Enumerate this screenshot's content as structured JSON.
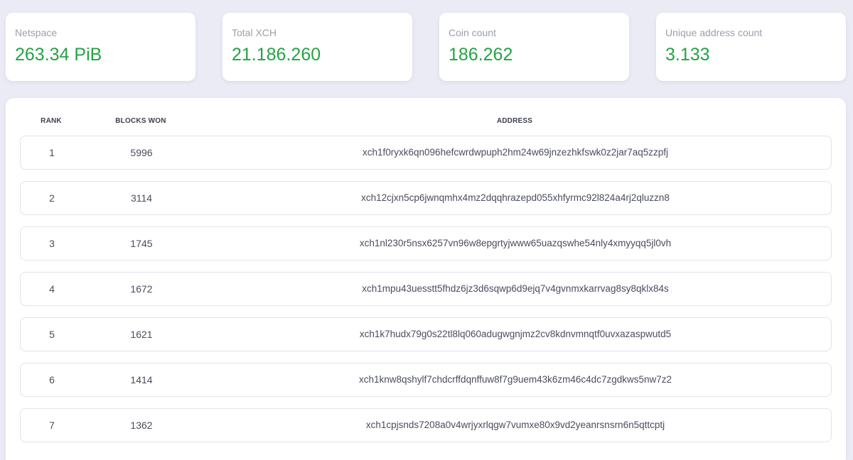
{
  "stats": [
    {
      "label": "Netspace",
      "value": "263.34 PiB"
    },
    {
      "label": "Total XCH",
      "value": "21.186.260"
    },
    {
      "label": "Coin count",
      "value": "186.262"
    },
    {
      "label": "Unique address count",
      "value": "3.133"
    }
  ],
  "table": {
    "headers": {
      "rank": "RANK",
      "blocks_won": "BLOCKS WON",
      "address": "ADDRESS"
    },
    "rows": [
      {
        "rank": "1",
        "blocks_won": "5996",
        "address": "xch1f0ryxk6qn096hefcwrdwpuph2hm24w69jnzezhkfswk0z2jar7aq5zzpfj"
      },
      {
        "rank": "2",
        "blocks_won": "3114",
        "address": "xch12cjxn5cp6jwnqmhx4mz2dqqhrazepd055xhfyrmc92l824a4rj2qluzzn8"
      },
      {
        "rank": "3",
        "blocks_won": "1745",
        "address": "xch1nl230r5nsx6257vn96w8epgrtyjwww65uazqswhe54nly4xmyyqq5jl0vh"
      },
      {
        "rank": "4",
        "blocks_won": "1672",
        "address": "xch1mpu43uesstt5fhdz6jz3d6sqwp6d9ejq7v4gvnmxkarrvag8sy8qklx84s"
      },
      {
        "rank": "5",
        "blocks_won": "1621",
        "address": "xch1k7hudx79g0s22tl8lq060adugwgnjmz2cv8kdnvmnqtf0uvxazaspwutd5"
      },
      {
        "rank": "6",
        "blocks_won": "1414",
        "address": "xch1knw8qshylf7chdcrffdqnffuw8f7g9uem43k6zm46c4dc7zgdkws5nw7z2"
      },
      {
        "rank": "7",
        "blocks_won": "1362",
        "address": "xch1cpjsnds7208a0v4wrjyxrlqgw7vumxe80x9vd2yeanrsnsrn6n5qttcptj"
      }
    ]
  },
  "colors": {
    "value_green": "#25a244",
    "label_gray": "#9aa0a9",
    "page_bg": "#ebebf5"
  }
}
